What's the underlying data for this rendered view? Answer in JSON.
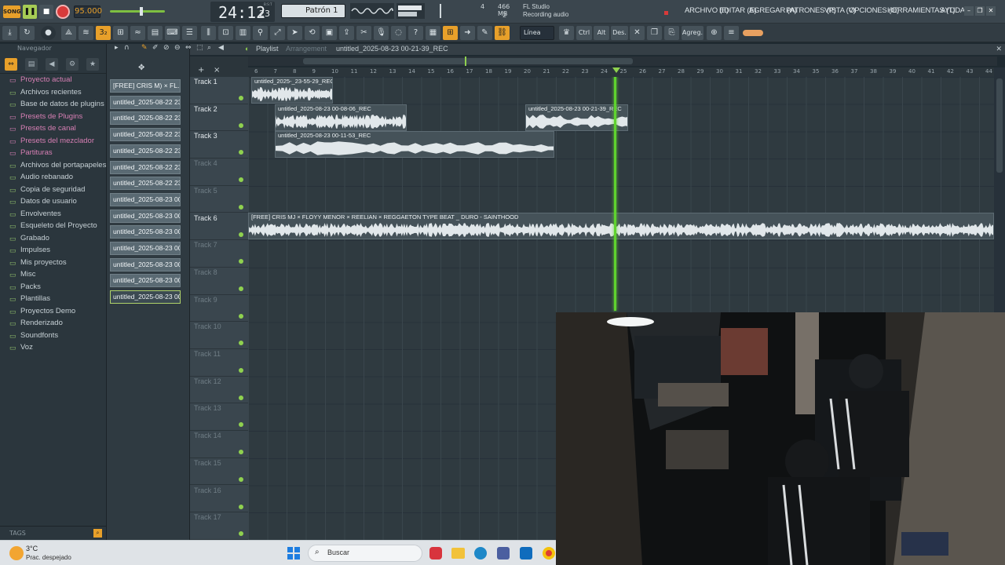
{
  "transport": {
    "song_badge": "SONG",
    "tempo": "95.000",
    "time": "24:12",
    "time_frac": "23",
    "time_label": "B:S:T",
    "pattern": "Patrón 1",
    "cpu": "4",
    "ram": "466 MB",
    "voices": "2",
    "app_name": "FL Studio",
    "status": "Recording audio"
  },
  "menu": {
    "file": "ARCHIVO (F)",
    "edit": "EDITAR (E)",
    "add": "AGREGAR (A)",
    "patterns": "PATRONES (P)",
    "view": "VISTA (V)",
    "options": "OPCIONES (O)",
    "tools": "HERRAMIENTAS (T)",
    "help": "AYUDA"
  },
  "toolbar": {
    "snap": "Línea",
    "ctrl": "Ctrl",
    "alt": "Alt",
    "des": "Des.",
    "agreg": "Agreg."
  },
  "browser": {
    "header": "Navegador",
    "items": [
      {
        "label": "Proyecto actual",
        "pink": true
      },
      {
        "label": "Archivos recientes",
        "pink": false
      },
      {
        "label": "Base de datos de plugins",
        "pink": false
      },
      {
        "label": "Presets de Plugins",
        "pink": true
      },
      {
        "label": "Presets de canal",
        "pink": true
      },
      {
        "label": "Presets del mezclador",
        "pink": true
      },
      {
        "label": "Partituras",
        "pink": true
      },
      {
        "label": "Archivos del portapapeles",
        "pink": false
      },
      {
        "label": "Audio rebanado",
        "pink": false
      },
      {
        "label": "Copia de seguridad",
        "pink": false
      },
      {
        "label": "Datos de usuario",
        "pink": false
      },
      {
        "label": "Envolventes",
        "pink": false
      },
      {
        "label": "Esqueleto del Proyecto",
        "pink": false
      },
      {
        "label": "Grabado",
        "pink": false
      },
      {
        "label": "Impulses",
        "pink": false
      },
      {
        "label": "Mis proyectos",
        "pink": false
      },
      {
        "label": "Misc",
        "pink": false
      },
      {
        "label": "Packs",
        "pink": false
      },
      {
        "label": "Plantillas",
        "pink": false
      },
      {
        "label": "Proyectos Demo",
        "pink": false
      },
      {
        "label": "Renderizado",
        "pink": false
      },
      {
        "label": "Soundfonts",
        "pink": false
      },
      {
        "label": "Voz",
        "pink": false
      }
    ],
    "tags": "TAGS"
  },
  "picker": [
    "[FREE] CRIS M) × FL..",
    "untitled_2025-08-22 23-..",
    "untitled_2025-08-22 23-..",
    "untitled_2025-08-22 23-..",
    "untitled_2025-08-22 23-..",
    "untitled_2025-08-22 23-..",
    "untitled_2025-08-22 23-..",
    "untitled_2025-08-23 00-..",
    "untitled_2025-08-23 00-..",
    "untitled_2025-08-23 00-..",
    "untitled_2025-08-23 00-..",
    "untitled_2025-08-23 00-..",
    "untitled_2025-08-23 00-..",
    "untitled_2025-08-23 00-.."
  ],
  "playlist": {
    "title": "Playlist",
    "sub": "Arrangement",
    "file": "untitled_2025-08-23 00-21-39_REC"
  },
  "ruler": [
    "6",
    "7",
    "8",
    "9",
    "10",
    "11",
    "12",
    "13",
    "14",
    "15",
    "16",
    "17",
    "18",
    "19",
    "20",
    "21",
    "22",
    "23",
    "24",
    "25",
    "26",
    "27",
    "28",
    "29",
    "30",
    "31",
    "32",
    "33",
    "34",
    "35",
    "36",
    "37",
    "38",
    "39",
    "40",
    "41",
    "42",
    "43",
    "44"
  ],
  "tracks": [
    "Track 1",
    "Track 2",
    "Track 3",
    "Track 4",
    "Track 5",
    "Track 6",
    "Track 7",
    "Track 8",
    "Track 9",
    "Track 10",
    "Track 11",
    "Track 12",
    "Track 13",
    "Track 14",
    "Track 15",
    "Track 16",
    "Track 17"
  ],
  "clips": [
    {
      "name": "untitled_2025-_23-55-29_REC",
      "track": 0
    },
    {
      "name": "untitled_2025-08-23 00-08-06_REC",
      "track": 1
    },
    {
      "name": "untitled_2025-08-23 00-21-39_REC",
      "track": 1
    },
    {
      "name": "untitled_2025-08-23 00-11-53_REC",
      "track": 2
    },
    {
      "name": "[FREE] CRIS MJ × FLOYY MENOR × REELIAN × REGGAETON TYPE BEAT _ DURO - SAINTHOOD",
      "track": 5
    }
  ],
  "taskbar": {
    "temp": "3°C",
    "weather": "Prac. despejado",
    "search": "Buscar"
  },
  "colors": {
    "accent": "#e8a02a",
    "playhead": "#5fd32f",
    "led": "#8fd14f"
  }
}
